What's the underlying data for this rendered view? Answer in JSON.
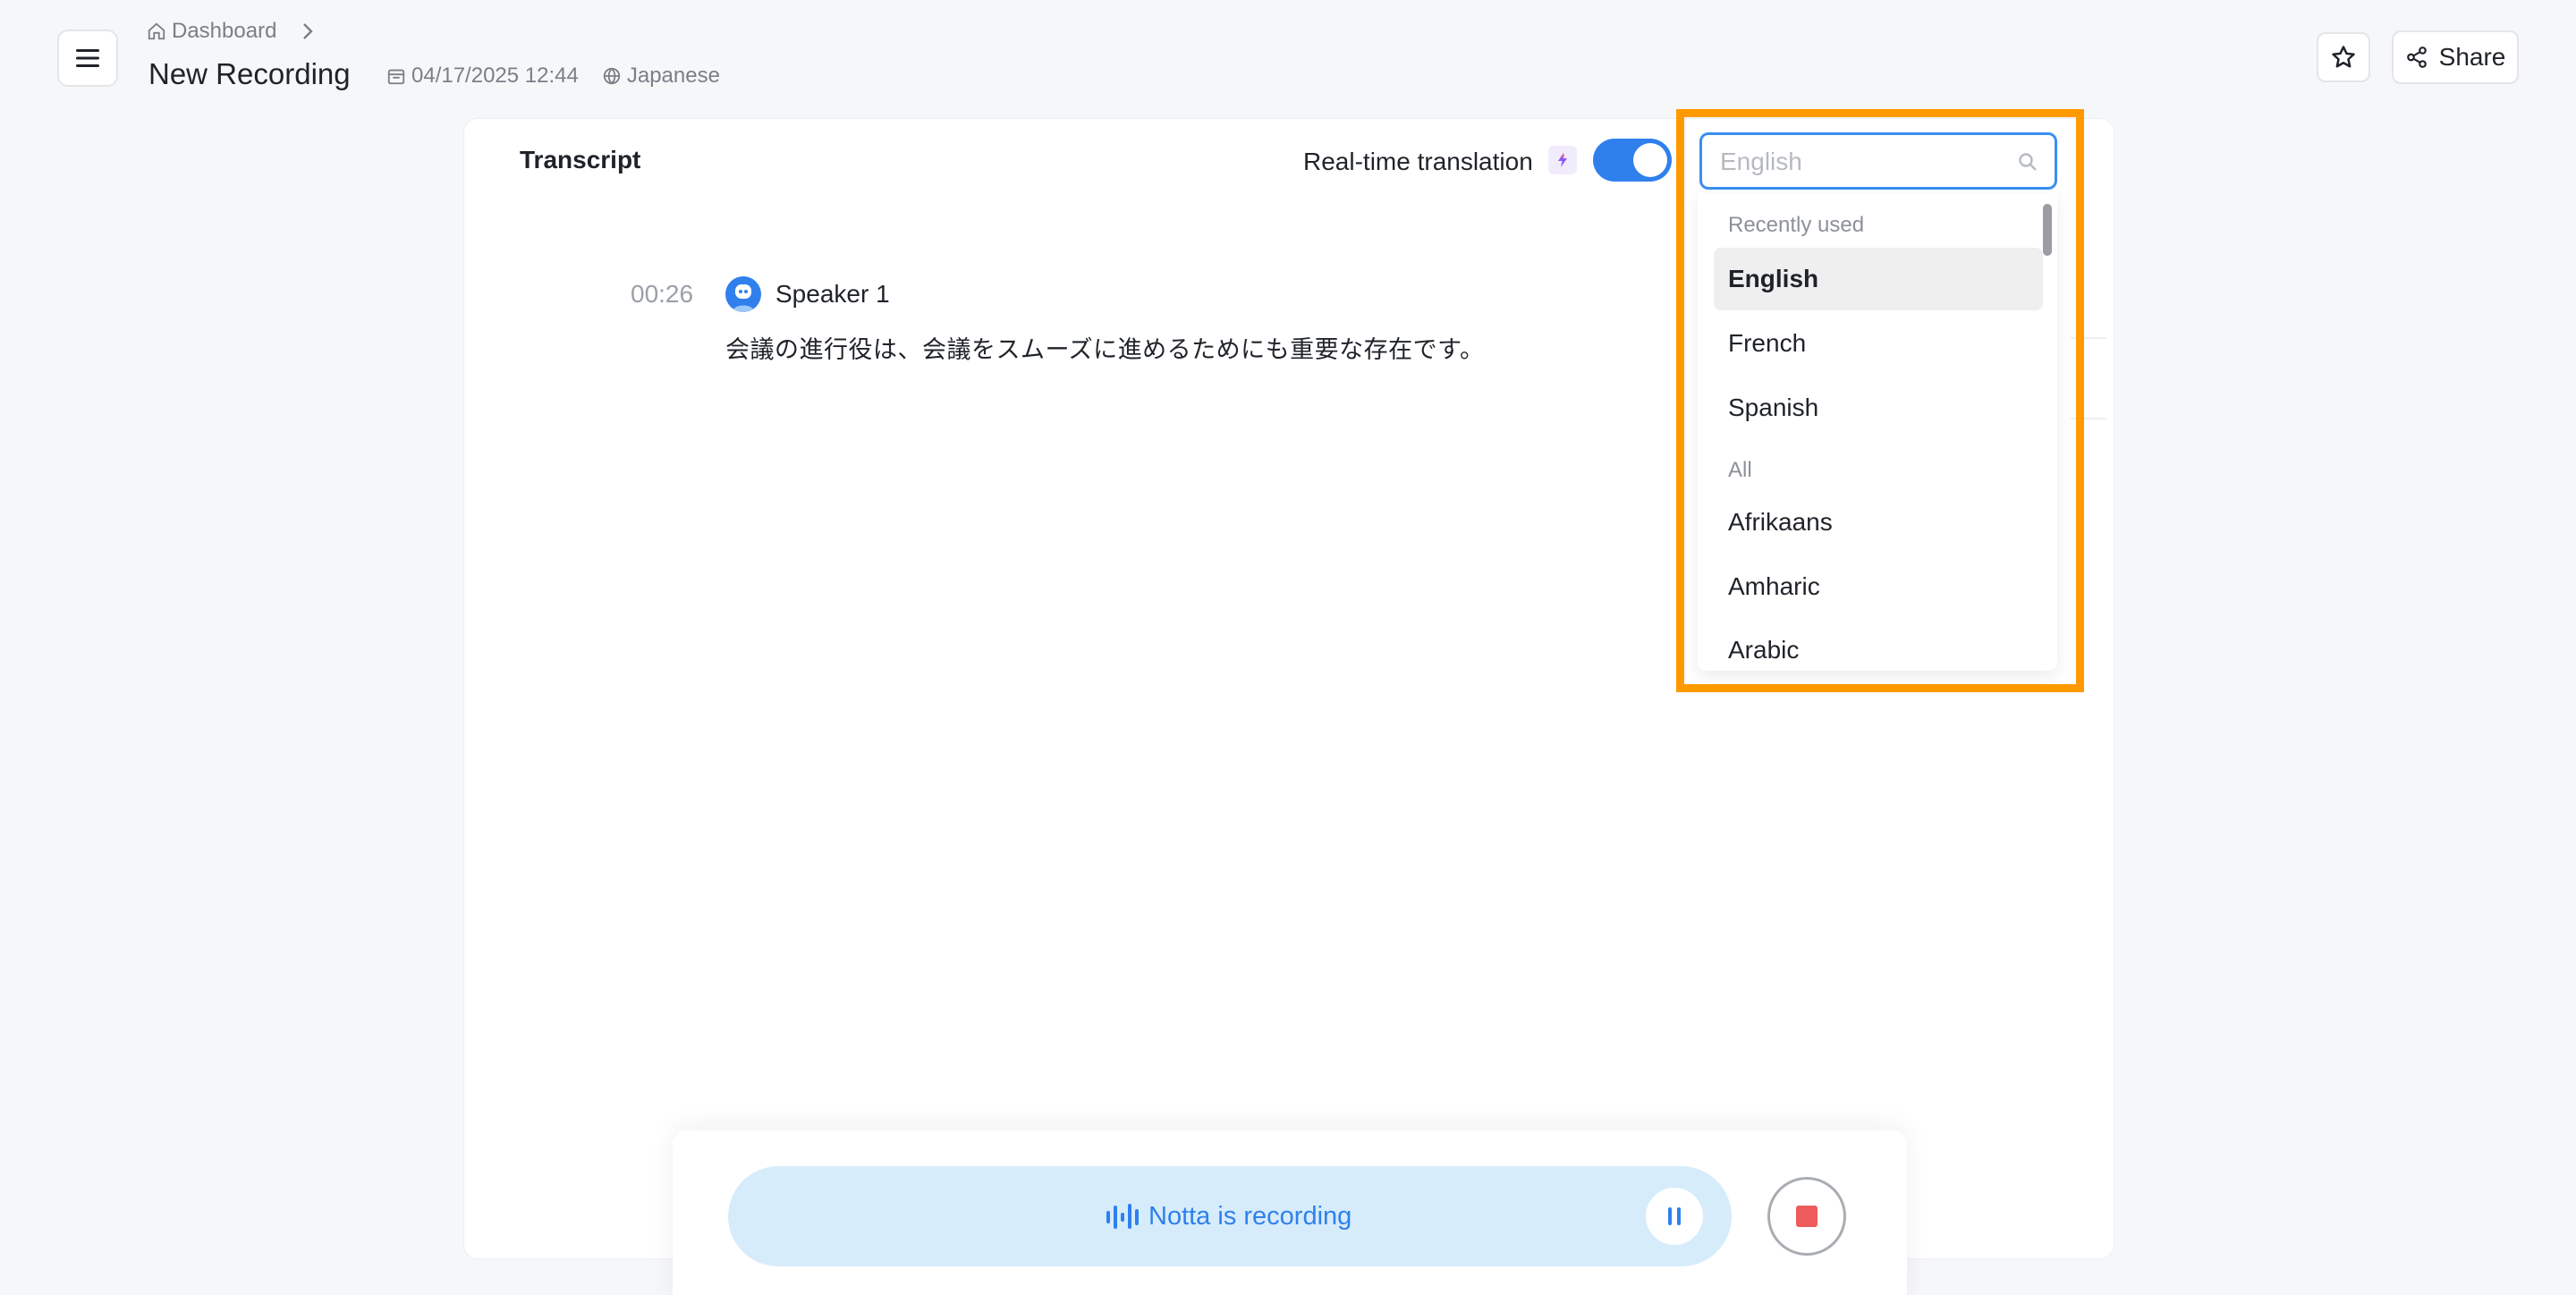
{
  "header": {
    "breadcrumb_home": "Dashboard",
    "title": "New Recording",
    "date": "04/17/2025 12:44",
    "language": "Japanese",
    "share_label": "Share"
  },
  "transcript": {
    "tab_label": "Transcript",
    "realtime_label": "Real-time translation",
    "realtime_enabled": true,
    "entries": [
      {
        "time": "00:26",
        "speaker": "Speaker 1",
        "text": "会議の進行役は、会議をスムーズに進めるためにも重要な存在です。"
      }
    ]
  },
  "language_dropdown": {
    "search_placeholder": "English",
    "group_recent": "Recently used",
    "recent": [
      "English",
      "French",
      "Spanish"
    ],
    "selected": "English",
    "group_all": "All",
    "all": [
      "Afrikaans",
      "Amharic",
      "Arabic"
    ]
  },
  "recorder": {
    "status_text": "Notta is recording"
  },
  "colors": {
    "accent": "#2f80ed",
    "highlight": "#ff9900",
    "stop": "#ee5b5b",
    "recording_pill": "#d6ecfb"
  }
}
